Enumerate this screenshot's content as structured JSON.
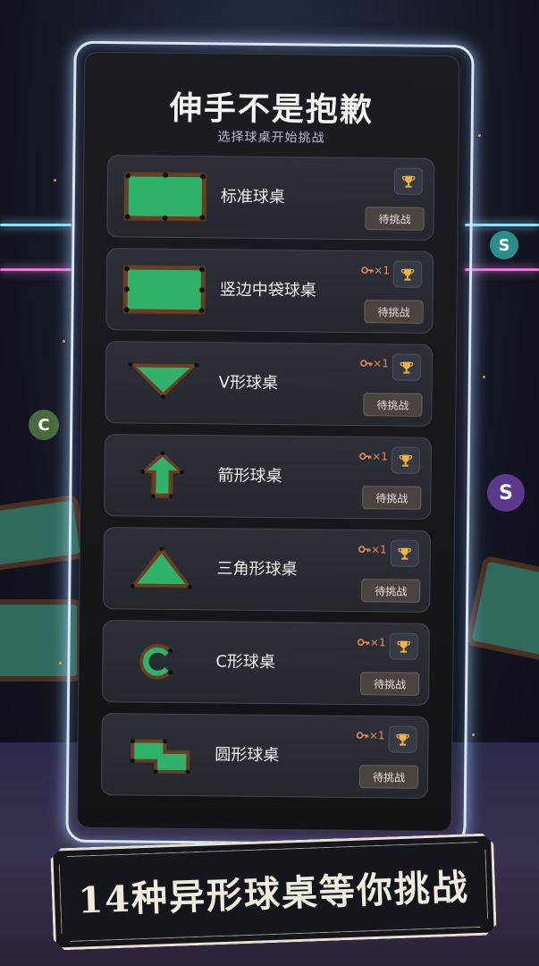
{
  "header": {
    "title": "伸手不是抱歉",
    "subtitle": "选择球桌开始挑战"
  },
  "tables": [
    {
      "name": "标准球桌",
      "shape": "rectangle",
      "key_count": "",
      "status": "待挑战"
    },
    {
      "name": "竖边中袋球桌",
      "shape": "rectangle-side-pockets",
      "key_count": "×1",
      "status": "待挑战"
    },
    {
      "name": "V形球桌",
      "shape": "v-shape",
      "key_count": "×1",
      "status": "待挑战"
    },
    {
      "name": "箭形球桌",
      "shape": "arrow",
      "key_count": "×1",
      "status": "待挑战"
    },
    {
      "name": "三角形球桌",
      "shape": "triangle",
      "key_count": "×1",
      "status": "待挑战"
    },
    {
      "name": "C形球桌",
      "shape": "c-shape",
      "key_count": "×1",
      "status": "待挑战"
    },
    {
      "name": "圆形球桌",
      "shape": "z-shape",
      "key_count": "×1",
      "status": "待挑战"
    }
  ],
  "banner": {
    "text": "14种异形球桌等你挑战"
  },
  "icons": {
    "trophy": "trophy-icon",
    "key": "key-icon"
  },
  "colors": {
    "felt_green": "#2fb36b",
    "rail_brown": "#6b3e23",
    "trophy_gold": "#f2b43b",
    "key_orange": "#e88a5a",
    "frame_glow": "#d8e6f5"
  }
}
